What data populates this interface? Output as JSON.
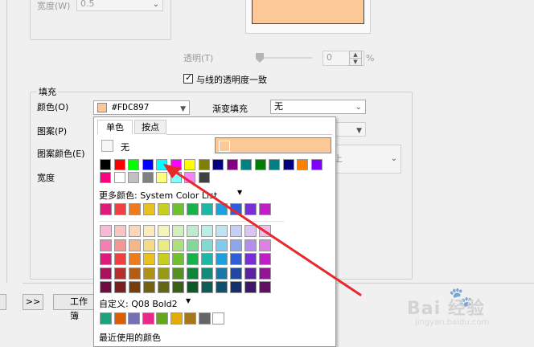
{
  "width_section": {
    "label": "宽度(W)",
    "value": "0.5"
  },
  "transparency": {
    "label": "透明(T)",
    "value": "0",
    "unit": "%",
    "slider_level": 0
  },
  "same_as_line_checkbox": {
    "label": "与线的透明度一致",
    "checked": true
  },
  "fill": {
    "title": "填充",
    "color_label": "颜色(O)",
    "color_value": "#FDC897",
    "gradient_label": "渐变填充",
    "gradient_value": "无",
    "pattern_label": "图案(P)",
    "pattern_color_label": "图案颜色(E)",
    "width_label": "宽度",
    "right_combo_fragment": "上"
  },
  "bottom_bar": {
    "next_button": ">>",
    "workspace_button": "工作簿"
  },
  "palette": {
    "tabs": [
      {
        "label": "单色",
        "active": true
      },
      {
        "label": "按点",
        "active": false
      }
    ],
    "none_label": "无",
    "selected_color": "#FDC897",
    "more_colors_label": "更多颜色: System Color List",
    "custom_label": "自定义: Q08 Bold2",
    "recent_label": "最近使用的颜色",
    "basic_row1": [
      "#000000",
      "#ff0000",
      "#00ff00",
      "#0000ff",
      "#00ffff",
      "#ff00ff",
      "#ffff00",
      "#808000",
      "#000080",
      "#800080",
      "#008080",
      "#008000",
      "#008080",
      "#000080",
      "#ff8000",
      "#8000ff"
    ],
    "basic_row2": [
      "#ff0080",
      "#ffffff",
      "#c0c0c0",
      "#808080",
      "#ffff80",
      "#80ffff",
      "#ff80ff",
      "#404040"
    ],
    "system_row": [
      "#e0197d",
      "#f33f3f",
      "#f07b1a",
      "#e8c21e",
      "#c8cf1e",
      "#6fc22e",
      "#17b24a",
      "#1bb8a5",
      "#1d9fe0",
      "#2e5fd8",
      "#7a2ed8",
      "#c21ec8"
    ],
    "shade_rows": [
      [
        "#f9b9d6",
        "#fbc4c4",
        "#fbd6bb",
        "#fbebbd",
        "#f3f5bd",
        "#d3efbd",
        "#bdebcb",
        "#bdede7",
        "#bde3f5",
        "#c5cff3",
        "#d9c5f3",
        "#efbdf0"
      ],
      [
        "#f47fb0",
        "#f79494",
        "#f7b683",
        "#f5dc82",
        "#e8ec82",
        "#acdf7e",
        "#83d79b",
        "#7fdacf",
        "#7fcaee",
        "#8fa5ea",
        "#b38fea",
        "#e07fe4"
      ],
      [
        "#e0197d",
        "#f33f3f",
        "#f07b1a",
        "#e8c21e",
        "#c8cf1e",
        "#6fc22e",
        "#17b24a",
        "#1bb8a5",
        "#1d9fe0",
        "#2e5fd8",
        "#7a2ed8",
        "#c21ec8"
      ],
      [
        "#a8125d",
        "#b52f2f",
        "#b45c13",
        "#ae9116",
        "#969b16",
        "#539123",
        "#118537",
        "#148a7b",
        "#1677a8",
        "#2247a2",
        "#5b22a2",
        "#911696"
      ],
      [
        "#700c3e",
        "#791f1f",
        "#783d0d",
        "#74610f",
        "#64670f",
        "#386117",
        "#0b5925",
        "#0e5c52",
        "#0f4f70",
        "#16306c",
        "#3d166c",
        "#610f64"
      ]
    ],
    "custom_row": [
      "#1aa37e",
      "#d95f02",
      "#7570b3",
      "#e7298a",
      "#66a61e",
      "#e6ab02",
      "#a6761d",
      "#666666",
      "#ffffff"
    ]
  },
  "watermark": {
    "text": "Bai 经验",
    "subtext": "jingyan.baidu.com"
  }
}
